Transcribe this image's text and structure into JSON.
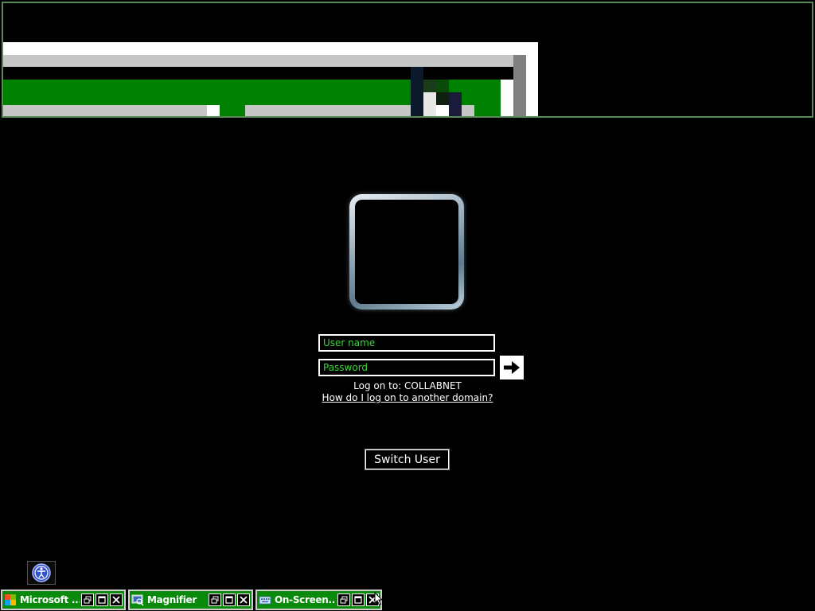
{
  "logon": {
    "username_placeholder": "User name",
    "password_placeholder": "Password",
    "log_on_to": "Log on to: COLLABNET",
    "domain_link": "How do I log on to another domain?",
    "switch_user": "Switch User"
  },
  "minimized_windows": [
    {
      "title": "Microsoft ...",
      "icon": "app-icon"
    },
    {
      "title": "Magnifier",
      "icon": "magnifier-icon"
    },
    {
      "title": "On-Screen...",
      "icon": "keyboard-icon"
    }
  ],
  "colors": {
    "background": "#000000",
    "accent_green": "#0a8a0a",
    "field_text": "#3bd63b"
  }
}
